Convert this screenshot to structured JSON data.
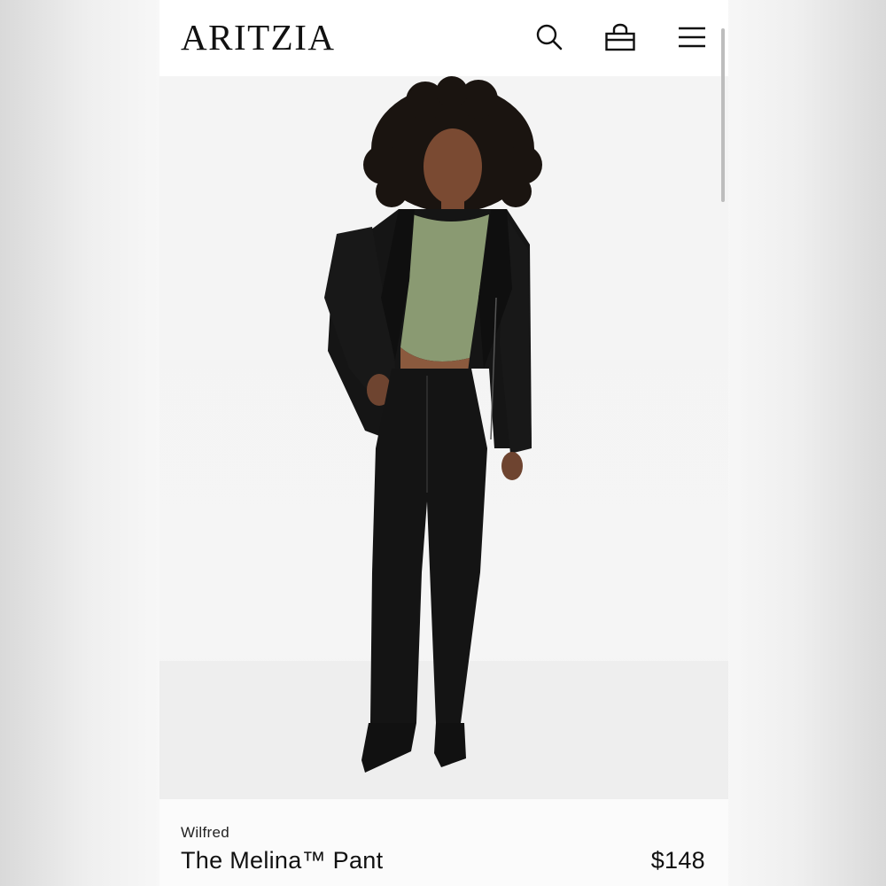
{
  "header": {
    "logo_text": "ARITZIA",
    "icons": [
      "search-icon",
      "bag-icon",
      "menu-icon"
    ]
  },
  "hero": {
    "image_subject": "model wearing black leather jacket, green crop top and black leather pants"
  },
  "product": {
    "brand": "Wilfred",
    "name": "The Melina™ Pant",
    "price": "$148"
  },
  "colors": {
    "background": "#ffffff",
    "text": "#111111",
    "top_garment": "#8a9a72",
    "leather": "#141414"
  }
}
